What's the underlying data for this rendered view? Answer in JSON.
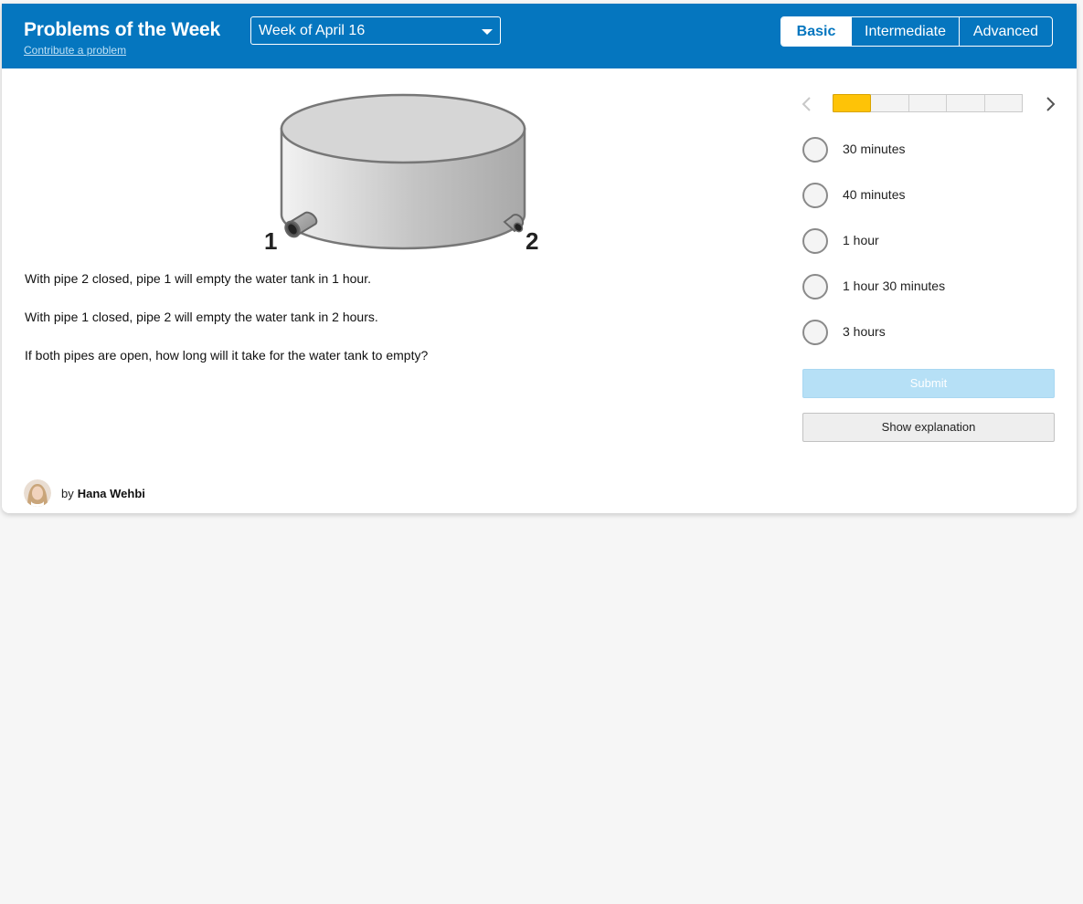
{
  "header": {
    "title": "Problems of the Week",
    "contribute_link": "Contribute a problem",
    "week_select": {
      "selected": "Week of April 16"
    },
    "levels": [
      {
        "label": "Basic",
        "active": true
      },
      {
        "label": "Intermediate",
        "active": false
      },
      {
        "label": "Advanced",
        "active": false
      }
    ],
    "colors": {
      "brand_blue": "#0576bf",
      "progress_yellow": "#fec307"
    }
  },
  "figure": {
    "pipe_labels": [
      "1",
      "2"
    ]
  },
  "problem": {
    "lines": [
      "With pipe 2 closed, pipe 1 will empty the water tank in 1 hour.",
      "With pipe 1 closed, pipe 2 will empty the water tank in 2 hours.",
      "If both pipes are open, how long will it take for the water tank to empty?"
    ]
  },
  "progress": {
    "current": 1,
    "total": 5,
    "prev_icon": "chevron-left-icon",
    "next_icon": "chevron-right-icon"
  },
  "options": [
    {
      "label": "30 minutes"
    },
    {
      "label": "40 minutes"
    },
    {
      "label": "1 hour"
    },
    {
      "label": "1 hour 30 minutes"
    },
    {
      "label": "3 hours"
    }
  ],
  "actions": {
    "submit_label": "Submit",
    "explain_label": "Show explanation"
  },
  "author": {
    "by": "by",
    "name": "Hana Wehbi"
  }
}
